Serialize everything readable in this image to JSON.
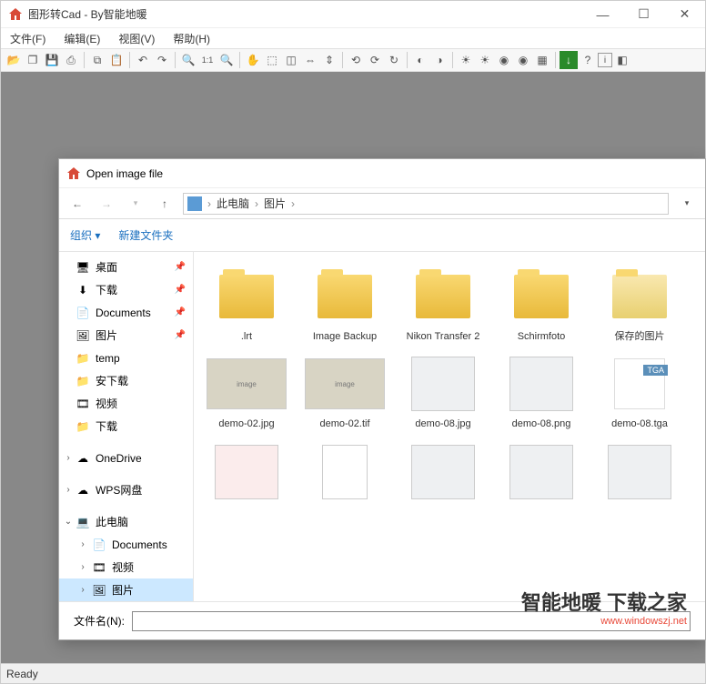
{
  "app": {
    "title": "图形转Cad - By智能地暖",
    "menus": [
      "文件(F)",
      "编辑(E)",
      "视图(V)",
      "帮助(H)"
    ],
    "status": "Ready"
  },
  "toolbar_icons": [
    "open",
    "copy-win",
    "save",
    "print",
    "sep",
    "copy",
    "paste",
    "sep",
    "undo",
    "redo",
    "sep",
    "zoom-in",
    "zoom-1-1",
    "zoom-out",
    "sep",
    "pan",
    "select",
    "crop",
    "flip-h",
    "flip-v",
    "sep",
    "rot-left",
    "rot-right",
    "rot-free",
    "sep",
    "contrast",
    "bright",
    "sep",
    "adj1",
    "adj2",
    "adj3",
    "adj4",
    "adj5",
    "sep",
    "go",
    "help",
    "i",
    "unk"
  ],
  "dialog": {
    "title": "Open image file",
    "breadcrumb": [
      "此电脑",
      "图片"
    ],
    "toolbar": {
      "organize": "组织",
      "new_folder": "新建文件夹"
    },
    "filename_label": "文件名(N):",
    "filename_value": ""
  },
  "sidebar": [
    {
      "icon": "desktop",
      "label": "桌面",
      "pin": true
    },
    {
      "icon": "download",
      "label": "下载",
      "pin": true
    },
    {
      "icon": "docs",
      "label": "Documents",
      "pin": true
    },
    {
      "icon": "pics",
      "label": "图片",
      "pin": true
    },
    {
      "icon": "folder",
      "label": "temp"
    },
    {
      "icon": "folder",
      "label": "安下载"
    },
    {
      "icon": "video",
      "label": "视频"
    },
    {
      "icon": "folder",
      "label": "下载"
    },
    {
      "spacer": true
    },
    {
      "icon": "onedrive",
      "label": "OneDrive",
      "expand": ">"
    },
    {
      "spacer": true
    },
    {
      "icon": "wps",
      "label": "WPS网盘",
      "expand": ">"
    },
    {
      "spacer": true
    },
    {
      "icon": "pc",
      "label": "此电脑",
      "expand": "v"
    },
    {
      "icon": "docs",
      "label": "Documents",
      "indent": true,
      "expand": ">"
    },
    {
      "icon": "video",
      "label": "视频",
      "indent": true,
      "expand": ">"
    },
    {
      "icon": "pics",
      "label": "图片",
      "indent": true,
      "expand": ">",
      "selected": true
    }
  ],
  "files": [
    {
      "type": "folder",
      "name": ".lrt"
    },
    {
      "type": "folder",
      "name": "Image Backup"
    },
    {
      "type": "folder",
      "name": "Nikon Transfer 2"
    },
    {
      "type": "folder",
      "name": "Schirmfoto"
    },
    {
      "type": "folder-docs",
      "name": "保存的图片"
    },
    {
      "type": "img",
      "name": "demo-02.jpg"
    },
    {
      "type": "img",
      "name": "demo-02.tif"
    },
    {
      "type": "doc-img",
      "name": "demo-08.jpg"
    },
    {
      "type": "doc-img",
      "name": "demo-08.png"
    },
    {
      "type": "tga",
      "name": "demo-08.tga"
    },
    {
      "type": "doc-red",
      "name": ""
    },
    {
      "type": "blank-doc",
      "name": ""
    },
    {
      "type": "doc-img",
      "name": ""
    },
    {
      "type": "doc-img",
      "name": ""
    },
    {
      "type": "doc-img",
      "name": ""
    }
  ],
  "watermark": {
    "main": "智能地暖 下载之家",
    "url": "www.windowszj.net"
  }
}
